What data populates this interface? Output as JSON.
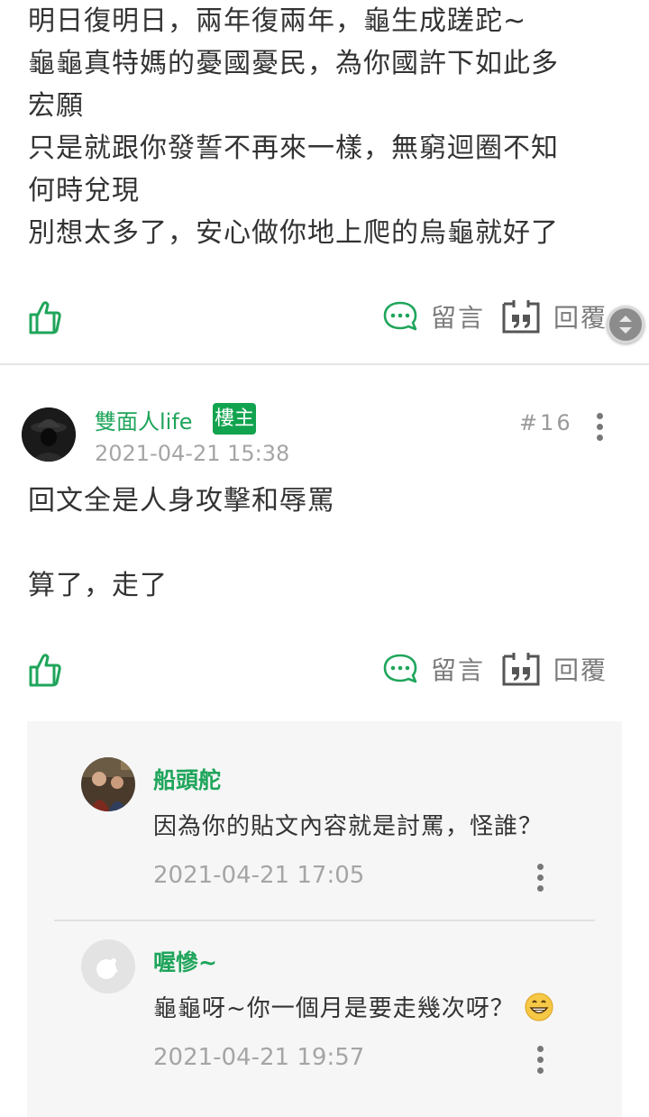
{
  "post_15": {
    "lines": [
      "明日復明日，兩年復兩年，龜生成蹉跎~",
      "龜龜真特媽的憂國憂民，為你國許下如此多",
      "宏願",
      "只是就跟你發誓不再來一樣，無窮迴圈不知",
      "何時兌現",
      "別想太多了，安心做你地上爬的烏龜就好了"
    ],
    "actions": {
      "comment_label": "留言",
      "reply_label": "回覆"
    }
  },
  "post_16": {
    "author": "雙面人life",
    "badge": "樓主",
    "timestamp": "2021-04-21 15:38",
    "floor": "#16",
    "lines": [
      "回文全是人身攻擊和辱罵",
      "算了，走了"
    ],
    "actions": {
      "comment_label": "留言",
      "reply_label": "回覆"
    },
    "replies": [
      {
        "author": "船頭舵",
        "text": "因為你的貼文內容就是討罵，怪誰？",
        "timestamp": "2021-04-21 17:05"
      },
      {
        "author": "喔慘~",
        "text": "龜龜呀~你一個月是要走幾次呀？",
        "emoji": "grinning-face-emoji",
        "timestamp": "2021-04-21 19:57"
      }
    ]
  },
  "colors": {
    "accent_green": "#1fa55b",
    "badge_green": "#12a34f",
    "muted_gray": "#a5a5a5",
    "reply_bg": "#f6f6f6"
  },
  "icons": [
    "thumbs-up-icon",
    "comment-bubble-icon",
    "quote-reply-icon",
    "more-vertical-icon",
    "scroll-handle-icon"
  ]
}
